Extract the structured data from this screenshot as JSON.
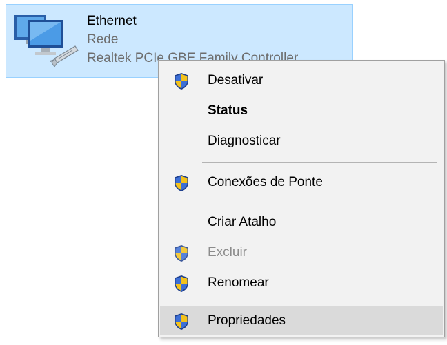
{
  "adapter": {
    "name": "Ethernet",
    "status": "Rede",
    "device": "Realtek PCIe GBE Family Controller",
    "icon": "network-adapter-icon",
    "selected_bg": "#cce8ff"
  },
  "context_menu": {
    "items": [
      {
        "label": "Desativar",
        "icon": "uac-shield-icon",
        "bold": false,
        "disabled": false
      },
      {
        "label": "Status",
        "icon": null,
        "bold": true,
        "disabled": false
      },
      {
        "label": "Diagnosticar",
        "icon": null,
        "bold": false,
        "disabled": false
      },
      {
        "label": "Conexões de Ponte",
        "icon": "uac-shield-icon",
        "bold": false,
        "disabled": false
      },
      {
        "label": "Criar Atalho",
        "icon": null,
        "bold": false,
        "disabled": false
      },
      {
        "label": "Excluir",
        "icon": "uac-shield-icon",
        "bold": false,
        "disabled": true
      },
      {
        "label": "Renomear",
        "icon": "uac-shield-icon",
        "bold": false,
        "disabled": false
      },
      {
        "label": "Propriedades",
        "icon": "uac-shield-icon",
        "bold": false,
        "disabled": false,
        "highlighted": true
      }
    ],
    "colors": {
      "menu_bg": "#f2f2f2",
      "hover_bg": "#dadada",
      "disabled_text": "#8c8c8c"
    }
  }
}
